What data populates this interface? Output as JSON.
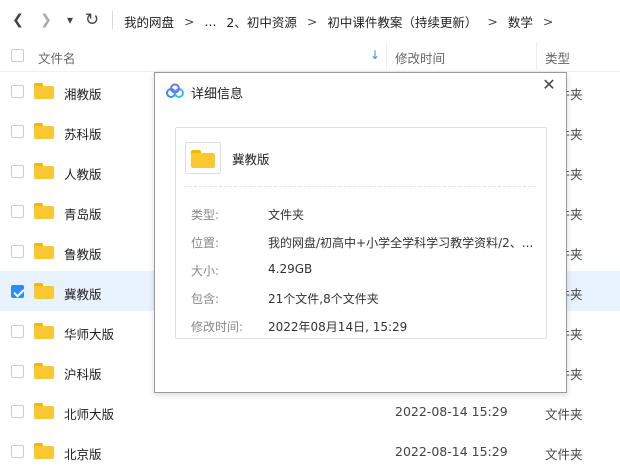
{
  "nav": {
    "back_glyph": "❮",
    "forward_glyph": "❯",
    "dropdown_glyph": "▾",
    "refresh_glyph": "↻",
    "breadcrumb": [
      "我的网盘",
      "...",
      "2、初中资源",
      "初中课件教案（持续更新）",
      "数学"
    ],
    "chevron": ">"
  },
  "table": {
    "headers": {
      "name": "文件名",
      "modified": "修改时间",
      "type": "类型"
    },
    "sort_arrow": "↓",
    "rows": [
      {
        "name": "湘教版",
        "time": "",
        "type": "文件夹",
        "selected": false
      },
      {
        "name": "苏科版",
        "time": "",
        "type": "文件夹",
        "selected": false
      },
      {
        "name": "人教版",
        "time": "",
        "type": "文件夹",
        "selected": false
      },
      {
        "name": "青岛版",
        "time": "",
        "type": "文件夹",
        "selected": false
      },
      {
        "name": "鲁教版",
        "time": "",
        "type": "文件夹",
        "selected": false
      },
      {
        "name": "冀教版",
        "time": "",
        "type": "文件夹",
        "selected": true
      },
      {
        "name": "华师大版",
        "time": "",
        "type": "文件夹",
        "selected": false
      },
      {
        "name": "沪科版",
        "time": "",
        "type": "文件夹",
        "selected": false
      },
      {
        "name": "北师大版",
        "time": "2022-08-14 15:29",
        "type": "文件夹",
        "selected": false
      },
      {
        "name": "北京版",
        "time": "2022-08-14 15:29",
        "type": "文件夹",
        "selected": false
      }
    ]
  },
  "dialog": {
    "title": "详细信息",
    "close_glyph": "✕",
    "file_name": "冀教版",
    "fields": [
      {
        "label": "类型:",
        "value": "文件夹"
      },
      {
        "label": "位置:",
        "value": "我的网盘/初高中+小学全学科学习教学资料/2、..."
      },
      {
        "label": "大小:",
        "value": "4.29GB"
      },
      {
        "label": "包含:",
        "value": "21个文件,8个文件夹"
      },
      {
        "label": "修改时间:",
        "value": "2022年08月14日, 15:29"
      }
    ]
  },
  "colors": {
    "accent": "#2f8cf0",
    "folder": "#fcc832",
    "selected_row": "#e8f3ff"
  }
}
